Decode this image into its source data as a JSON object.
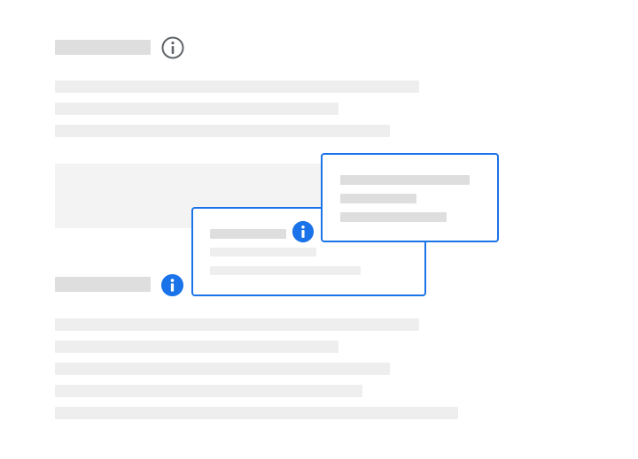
{
  "colors": {
    "accent": "#1a73e8",
    "placeholder_dark": "#dedede",
    "placeholder_light": "#eeeeee",
    "panel": "#f3f3f3",
    "outline_icon": "#5f6368"
  },
  "icons": {
    "section_1_info": "info-outline-icon",
    "section_2_info": "info-filled-icon",
    "popover_info": "info-filled-icon"
  }
}
